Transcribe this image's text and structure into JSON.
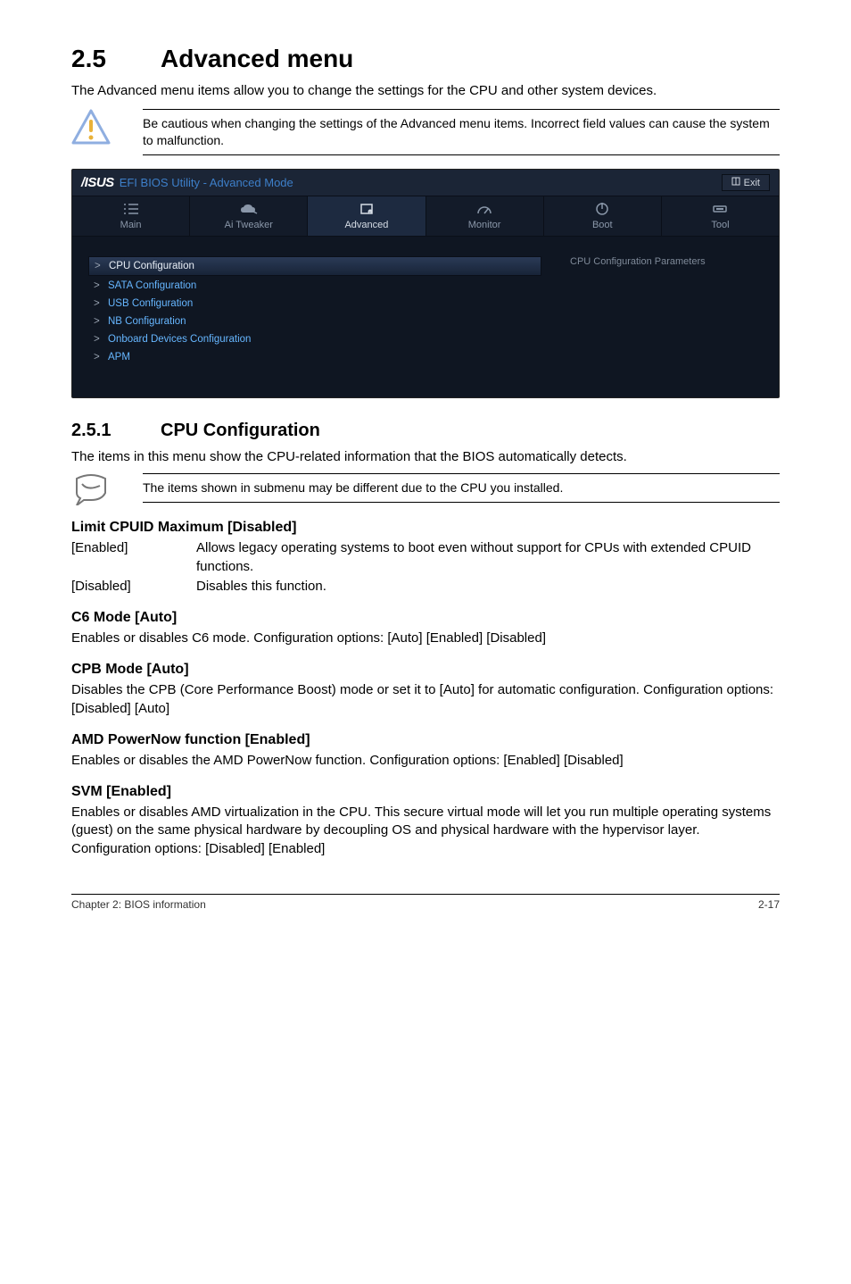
{
  "section": {
    "number": "2.5",
    "title": "Advanced menu"
  },
  "intro": "The Advanced menu items allow you to change the settings for the CPU and other system devices.",
  "warning_text": "Be cautious when changing the settings of the Advanced menu items. Incorrect field values can cause the system to malfunction.",
  "bios": {
    "logo_text": "/ISUS",
    "header_title": "EFI BIOS Utility - Advanced Mode",
    "exit_label": "Exit",
    "tabs": [
      {
        "label": "Main"
      },
      {
        "label": "Ai  Tweaker"
      },
      {
        "label": "Advanced"
      },
      {
        "label": "Monitor"
      },
      {
        "label": "Boot"
      },
      {
        "label": "Tool"
      }
    ],
    "menu_items": [
      "CPU Configuration",
      "SATA Configuration",
      "USB Configuration",
      "NB Configuration",
      "Onboard Devices Configuration",
      "APM"
    ],
    "right_panel": "CPU Configuration Parameters"
  },
  "subsection": {
    "number": "2.5.1",
    "title": "CPU Configuration"
  },
  "subsection_intro": "The items in this menu show the CPU-related information that the BIOS automatically detects.",
  "note_text": "The items shown in submenu may be different due to the CPU you installed.",
  "options": {
    "limit_cpuid": {
      "heading": "Limit CPUID Maximum [Disabled]",
      "rows": [
        {
          "k": "[Enabled]",
          "v": "Allows legacy operating systems to boot even without support for CPUs with extended CPUID functions."
        },
        {
          "k": "[Disabled]",
          "v": "Disables this function."
        }
      ]
    },
    "c6": {
      "heading": "C6 Mode [Auto]",
      "body": "Enables or disables C6 mode. Configuration options: [Auto] [Enabled] [Disabled]"
    },
    "cpb": {
      "heading": "CPB Mode [Auto]",
      "body": "Disables the CPB (Core Performance Boost) mode or set it to [Auto] for automatic configuration. Configuration options: [Disabled] [Auto]"
    },
    "powernow": {
      "heading": "AMD PowerNow function [Enabled]",
      "body": "Enables or disables the AMD PowerNow function. Configuration options: [Enabled] [Disabled]"
    },
    "svm": {
      "heading": "SVM [Enabled]",
      "body": "Enables or disables AMD virtualization in the CPU. This secure virtual mode will let you run multiple operating systems (guest) on the same physical hardware by decoupling OS and physical hardware with the hypervisor layer. Configuration options: [Disabled] [Enabled]"
    }
  },
  "footer": {
    "left": "Chapter 2: BIOS information",
    "right": "2-17"
  }
}
